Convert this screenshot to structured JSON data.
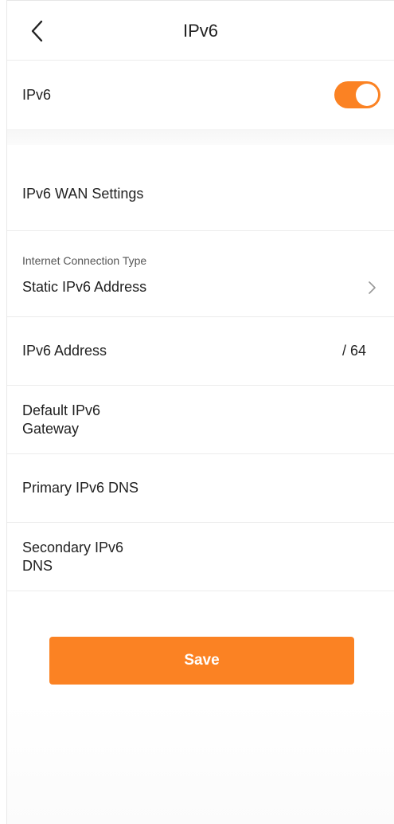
{
  "header": {
    "title": "IPv6",
    "back_icon": "chevron-left-icon"
  },
  "ipv6_toggle": {
    "label": "IPv6",
    "enabled": true,
    "accent_color": "#fb8223"
  },
  "wan_settings": {
    "section_label": "IPv6 WAN Settings",
    "connection_type": {
      "caption": "Internet Connection Type",
      "value": "Static IPv6 Address",
      "chevron_icon": "chevron-right-icon"
    },
    "address": {
      "label": "IPv6 Address",
      "value": "",
      "suffix": "/ 64"
    },
    "gateway": {
      "label_line1": "Default IPv6",
      "label_line2": "Gateway",
      "value": ""
    },
    "primary_dns": {
      "label": "Primary IPv6 DNS",
      "value": ""
    },
    "secondary_dns": {
      "label_line1": "Secondary IPv6",
      "label_line2": "DNS",
      "value": ""
    }
  },
  "actions": {
    "save_label": "Save"
  }
}
